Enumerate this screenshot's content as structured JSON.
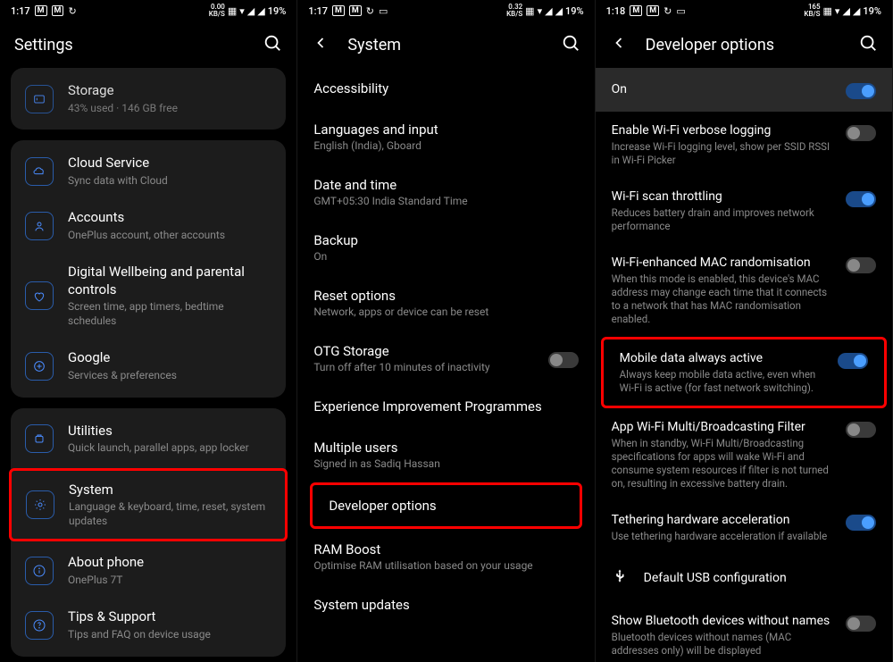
{
  "statusbars": [
    {
      "time": "1:17",
      "kbs": "0.00",
      "battery": "19%"
    },
    {
      "time": "1:17",
      "kbs": "0.32",
      "battery": "19%"
    },
    {
      "time": "1:18",
      "kbs": "165",
      "battery": "19%"
    }
  ],
  "panel1": {
    "title": "Settings",
    "items": [
      {
        "icon": "storage",
        "title": "Storage",
        "sub": "43% used · 146 GB free",
        "partial": true
      },
      {
        "group": true
      },
      {
        "icon": "cloud",
        "title": "Cloud Service",
        "sub": "Sync data with Cloud"
      },
      {
        "icon": "account",
        "title": "Accounts",
        "sub": "OnePlus account, other accounts"
      },
      {
        "icon": "wellbeing",
        "title": "Digital Wellbeing and parental controls",
        "sub": "Screen time, app timers, bedtime schedules"
      },
      {
        "icon": "google",
        "title": "Google",
        "sub": "Services & preferences"
      },
      {
        "group": true
      },
      {
        "icon": "utilities",
        "title": "Utilities",
        "sub": "Quick launch, parallel apps, app locker"
      },
      {
        "icon": "system",
        "title": "System",
        "sub": "Language & keyboard, time, reset, system updates",
        "highlight": true
      },
      {
        "icon": "about",
        "title": "About phone",
        "sub": "OnePlus 7T"
      },
      {
        "icon": "tips",
        "title": "Tips & Support",
        "sub": "Tips and FAQ on device usage"
      }
    ]
  },
  "panel2": {
    "title": "System",
    "items": [
      {
        "title": "Accessibility",
        "sub": ""
      },
      {
        "title": "Languages and input",
        "sub": "English (India), Gboard"
      },
      {
        "title": "Date and time",
        "sub": "GMT+05:30 India Standard Time"
      },
      {
        "title": "Backup",
        "sub": "On"
      },
      {
        "title": "Reset options",
        "sub": "Network, apps or device can be reset"
      },
      {
        "title": "OTG Storage",
        "sub": "Turn off after 10 minutes of inactivity",
        "toggle": false
      },
      {
        "title": "Experience Improvement Programmes",
        "sub": ""
      },
      {
        "title": "Multiple users",
        "sub": "Signed in as Sadiq Hassan"
      },
      {
        "title": "Developer options",
        "sub": "",
        "highlight": true
      },
      {
        "title": "RAM Boost",
        "sub": "Optimise RAM utilisation based on your usage"
      },
      {
        "title": "System updates",
        "sub": ""
      }
    ]
  },
  "panel3": {
    "title": "Developer options",
    "header": {
      "title": "On",
      "toggle": true
    },
    "items": [
      {
        "title": "Enable Wi-Fi verbose logging",
        "sub": "Increase Wi-Fi logging level, show per SSID RSSI in Wi-Fi Picker",
        "toggle": false
      },
      {
        "title": "Wi-Fi scan throttling",
        "sub": "Reduces battery drain and improves network performance",
        "toggle": true
      },
      {
        "title": "Wi-Fi-enhanced MAC randomisation",
        "sub": "When this mode is enabled, this device's MAC address may change each time that it connects to a network that has MAC randomisation enabled.",
        "toggle": false
      },
      {
        "title": "Mobile data always active",
        "sub": "Always keep mobile data active, even when Wi-Fi is active (for fast network switching).",
        "toggle": true,
        "highlight": true
      },
      {
        "title": "App Wi-Fi Multi/Broadcasting Filter",
        "sub": "When in standby, Wi-Fi Multi/Broadcasting specifications for apps will wake Wi-Fi and consume system resources if filter is not turned on, resulting in excessive battery drain.",
        "toggle": false
      },
      {
        "title": "Tethering hardware acceleration",
        "sub": "Use tethering hardware acceleration if available",
        "toggle": true
      },
      {
        "type": "usb",
        "title": "Default USB configuration"
      },
      {
        "title": "Show Bluetooth devices without names",
        "sub": "Bluetooth devices without names (MAC addresses only) will be displayed",
        "toggle": false
      }
    ]
  }
}
